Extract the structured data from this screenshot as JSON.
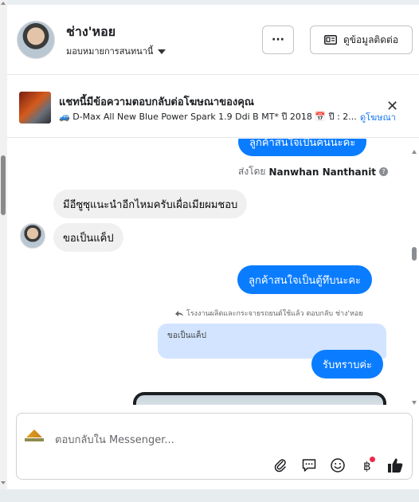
{
  "header": {
    "name": "ช่าง'หอย",
    "assignment": "มอบหมายการสนทนานี้",
    "more_label": "···",
    "contact_label": "ดูข้อมูลติดต่อ"
  },
  "ad": {
    "title": "แชทนี้มีข้อความตอบกลับต่อโฆษณาของคุณ",
    "description": "🚙 D-Max All New Blue Power Spark 1.9 Ddi B MT* ปี 2018 📅 ปี : 2...",
    "link_label": "ดูโฆษณา",
    "close_label": "✕"
  },
  "messages": {
    "top_partial": "ลูกค้าสนใจเป็นคนนะคะ",
    "sent_by_prefix": "ส่งโดย",
    "sent_by_name": "Nanwhan Nanthanit",
    "incoming_1": "มีอีซูซุแนะนำอีกไหมครับเผื่อเมียผมชอบ",
    "incoming_2": "ขอเป็นแค็ป",
    "outgoing_1": "ลูกค้าสนใจเป็นตู้ทึบนะคะ",
    "reply_note": "โรงงานผลิตและกระจายรถยนต์ใช้แล้ว ตอบกลับ ช่าง'หอย",
    "quoted_text": "ขอเป็นแค็ป",
    "outgoing_2": "รับทราบค่ะ"
  },
  "composer": {
    "placeholder": "ตอบกลับใน Messenger..."
  },
  "icons": [
    "more-icon",
    "contact-card-icon",
    "close-icon",
    "info-icon",
    "reply-arrow-icon",
    "attach-icon",
    "saved-replies-icon",
    "emoji-icon",
    "payment-icon",
    "thumbs-up-icon"
  ],
  "colors": {
    "accent": "#0a7cff",
    "link": "#1877f2",
    "incoming_bubble": "#f0f0f0",
    "quoted_bubble": "#d2e4ff",
    "notification": "#f02849"
  }
}
